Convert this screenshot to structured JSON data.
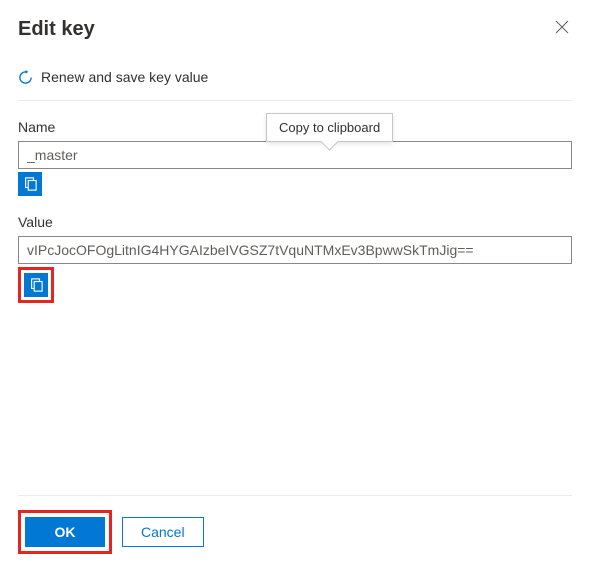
{
  "dialog": {
    "title": "Edit key",
    "renew_label": "Renew and save key value"
  },
  "tooltip": {
    "copy": "Copy to clipboard"
  },
  "fields": {
    "name": {
      "label": "Name",
      "value": "_master"
    },
    "value": {
      "label": "Value",
      "value": "vIPcJocOFOgLitnIG4HYGAIzbeIVGSZ7tVquNTMxEv3BpwwSkTmJig=="
    }
  },
  "buttons": {
    "ok": "OK",
    "cancel": "Cancel"
  }
}
